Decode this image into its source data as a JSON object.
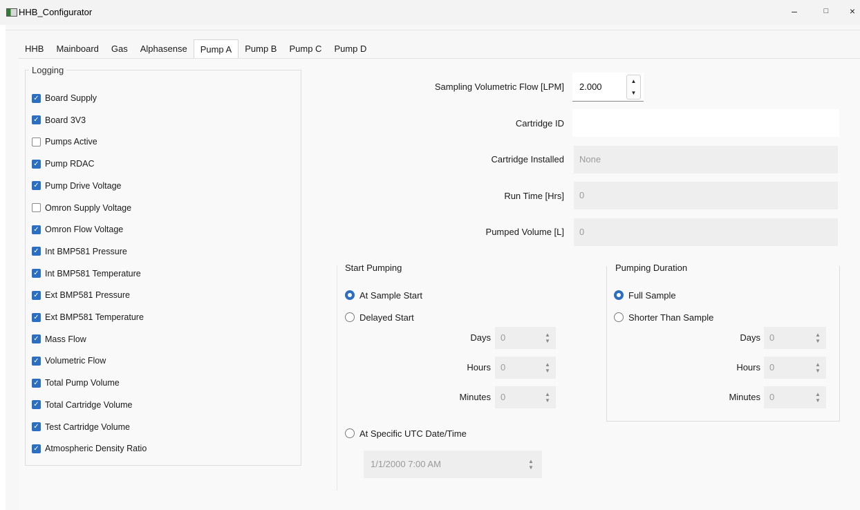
{
  "window": {
    "title": "HHB_Configurator",
    "minimize": "–",
    "maximize": "□",
    "close": "×"
  },
  "tabs": [
    {
      "label": "HHB"
    },
    {
      "label": "Mainboard"
    },
    {
      "label": "Gas"
    },
    {
      "label": "Alphasense"
    },
    {
      "label": "Pump A",
      "active": true
    },
    {
      "label": "Pump B"
    },
    {
      "label": "Pump C"
    },
    {
      "label": "Pump D"
    }
  ],
  "logging": {
    "title": "Logging",
    "items": [
      {
        "label": "Board Supply",
        "checked": true
      },
      {
        "label": "Board 3V3",
        "checked": true
      },
      {
        "label": "Pumps Active",
        "checked": false
      },
      {
        "label": "Pump RDAC",
        "checked": true
      },
      {
        "label": "Pump Drive Voltage",
        "checked": true
      },
      {
        "label": "Omron Supply Voltage",
        "checked": false
      },
      {
        "label": "Omron Flow Voltage",
        "checked": true
      },
      {
        "label": "Int BMP581 Pressure",
        "checked": true
      },
      {
        "label": "Int BMP581 Temperature",
        "checked": true
      },
      {
        "label": "Ext BMP581 Pressure",
        "checked": true
      },
      {
        "label": "Ext BMP581 Temperature",
        "checked": true
      },
      {
        "label": "Mass Flow",
        "checked": true
      },
      {
        "label": "Volumetric Flow",
        "checked": true
      },
      {
        "label": "Total Pump Volume",
        "checked": true
      },
      {
        "label": "Total Cartridge Volume",
        "checked": true
      },
      {
        "label": "Test Cartridge Volume",
        "checked": true
      },
      {
        "label": "Atmospheric Density Ratio",
        "checked": true
      }
    ]
  },
  "settings": {
    "flow_label": "Sampling Volumetric Flow [LPM]",
    "flow_value": "2.000",
    "cartridge_id_label": "Cartridge ID",
    "cartridge_id_value": "",
    "cartridge_installed_label": "Cartridge Installed",
    "cartridge_installed_value": "None",
    "run_time_label": "Run Time [Hrs]",
    "run_time_value": "0",
    "pumped_volume_label": "Pumped Volume [L]",
    "pumped_volume_value": "0"
  },
  "start_pumping": {
    "title": "Start Pumping",
    "option_sample_start": "At Sample Start",
    "option_delayed": "Delayed Start",
    "days_label": "Days",
    "days_value": "0",
    "hours_label": "Hours",
    "hours_value": "0",
    "minutes_label": "Minutes",
    "minutes_value": "0",
    "option_utc": "At Specific UTC Date/Time",
    "datetime_value": "1/1/2000 7:00 AM",
    "selected": "At Sample Start"
  },
  "pumping_duration": {
    "title": "Pumping Duration",
    "option_full": "Full Sample",
    "option_shorter": "Shorter Than Sample",
    "days_label": "Days",
    "days_value": "0",
    "hours_label": "Hours",
    "hours_value": "0",
    "minutes_label": "Minutes",
    "minutes_value": "0",
    "selected": "Full Sample"
  },
  "colors": {
    "accent": "#2c6ebf",
    "disabled_field": "#eeeeee",
    "panel": "#f9f9f9"
  }
}
